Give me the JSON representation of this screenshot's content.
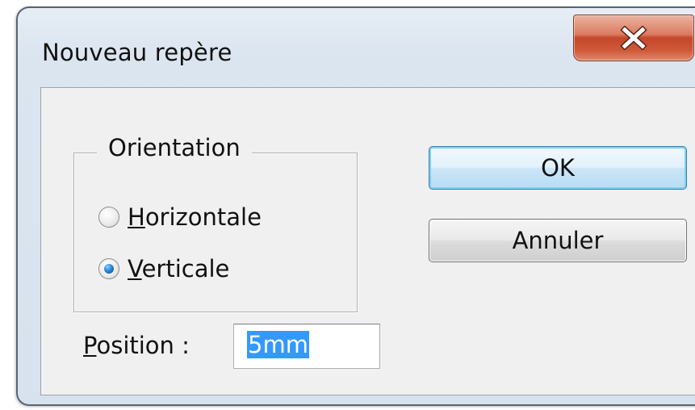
{
  "window": {
    "title": "Nouveau repère",
    "close_icon": "close-x-icon"
  },
  "orientation": {
    "legend": "Orientation",
    "options": [
      {
        "mnemonic": "H",
        "rest": "orizontale",
        "checked": false
      },
      {
        "mnemonic": "V",
        "rest": "erticale",
        "checked": true
      }
    ]
  },
  "buttons": {
    "ok_label": "OK",
    "cancel_label": "Annuler"
  },
  "position": {
    "label_mnemonic": "P",
    "label_rest": "osition :",
    "value": "5mm"
  },
  "colors": {
    "close_button": "#c4472a",
    "selection": "#3399ff",
    "default_button_border": "#3c7fb1"
  }
}
